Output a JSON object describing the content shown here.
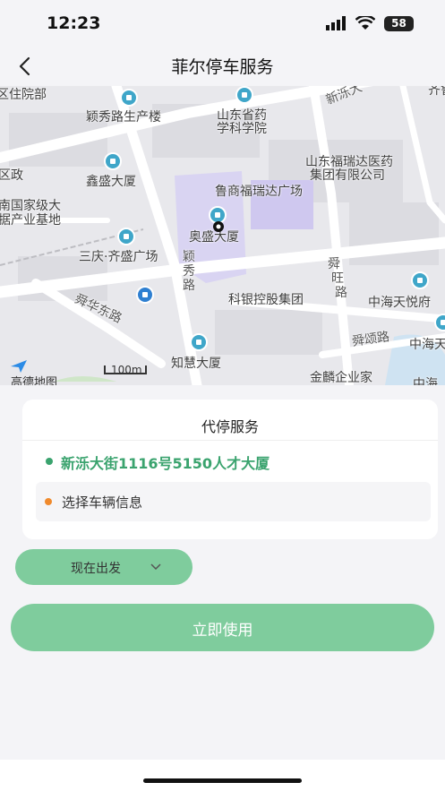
{
  "status_bar": {
    "time": "12:23",
    "battery": "58"
  },
  "nav": {
    "title": "菲尔停车服务"
  },
  "map": {
    "labels": {
      "l1": "区住院部",
      "l2": "颖秀路生产楼",
      "l3": "山东省药",
      "l4": "学科学院",
      "l5": "新泺大",
      "l6": "齐鲁",
      "l7": "山东福瑞达医药",
      "l8": "集团有限公司",
      "l9": "区政",
      "l10": "鑫盛大厦",
      "l11": "鲁商福瑞达广场",
      "l12": "南国家级大",
      "l13": "据产业基地",
      "l14": "奥盛大厦",
      "l15": "三庆·齐盛广场",
      "l16": "颖",
      "l17": "秀",
      "l18": "路",
      "l19": "舜",
      "l20": "旺",
      "l21": "路",
      "l22": "科银控股集团",
      "l23": "中海天悦府",
      "l24": "舜华东路",
      "l25": "舜颂路",
      "l26": "中海天",
      "l27": "知慧大厦",
      "l28": "金麟企业家",
      "l29": "中海"
    },
    "brand": "高德地图",
    "scale": "100m"
  },
  "card": {
    "title": "代停服务",
    "address": "新泺大街1116号5150人才大厦",
    "vehicle_placeholder": "选择车辆信息"
  },
  "depart_button": {
    "label": "现在出发"
  },
  "use_button": {
    "label": "立即使用"
  },
  "colors": {
    "accent": "#7fcc9d",
    "address": "#3aa36e",
    "dot_green": "#3aa36e",
    "dot_orange": "#f08a2c"
  }
}
